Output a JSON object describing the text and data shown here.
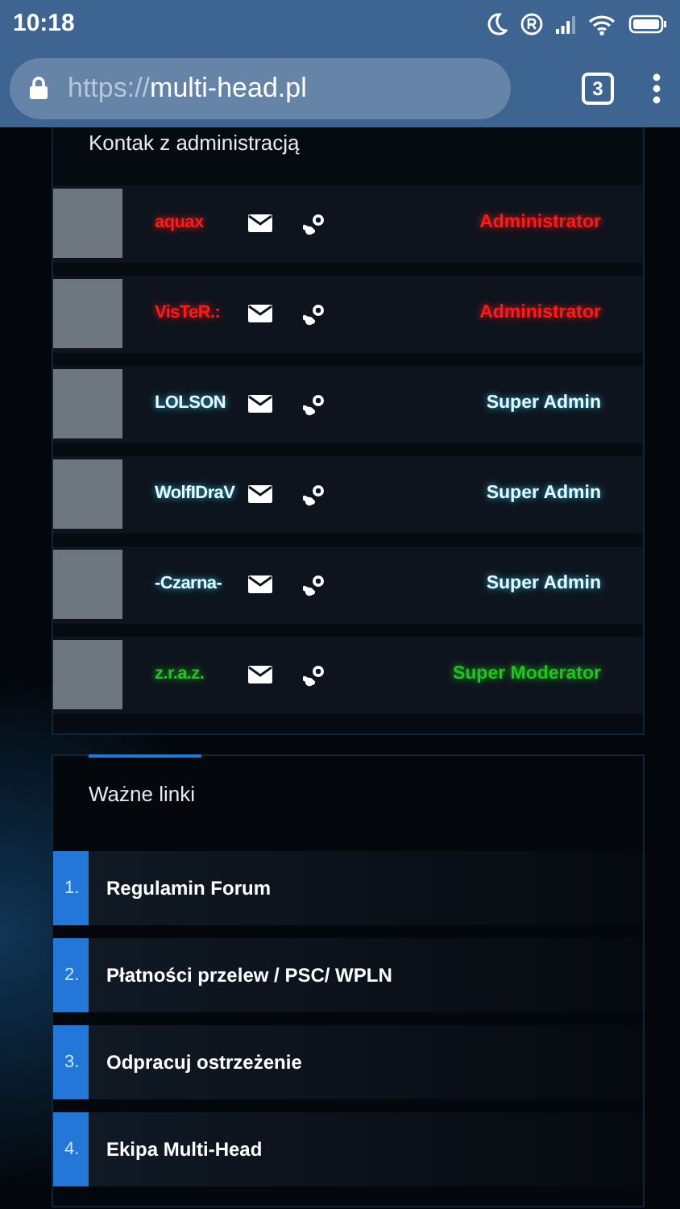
{
  "status_bar": {
    "time": "10:18"
  },
  "browser": {
    "url_scheme": "https://",
    "url_host": "multi-head.pl",
    "tab_count": "3"
  },
  "admin_panel": {
    "title": "Kontak z administracją",
    "members": [
      {
        "name": "aquax",
        "role": "Administrator",
        "color": "#ff1a1a"
      },
      {
        "name": "VisTeR.:",
        "role": "Administrator",
        "color": "#ff1a1a"
      },
      {
        "name": "LOLSON",
        "role": "Super Admin",
        "color": "#e6fbff"
      },
      {
        "name": "WolfIDraV",
        "role": "Super Admin",
        "color": "#e6fbff"
      },
      {
        "name": "-Czarna-",
        "role": "Super Admin",
        "color": "#e6fbff"
      },
      {
        "name": "z.r.a.z.",
        "role": "Super Moderator",
        "color": "#22c21f"
      }
    ]
  },
  "links_panel": {
    "title": "Ważne linki",
    "links": [
      {
        "number": "1.",
        "label": "Regulamin Forum"
      },
      {
        "number": "2.",
        "label": "Płatności przelew / PSC/ WPLN"
      },
      {
        "number": "3.",
        "label": "Odpracuj ostrzeżenie"
      },
      {
        "number": "4.",
        "label": "Ekipa Multi-Head"
      }
    ]
  }
}
